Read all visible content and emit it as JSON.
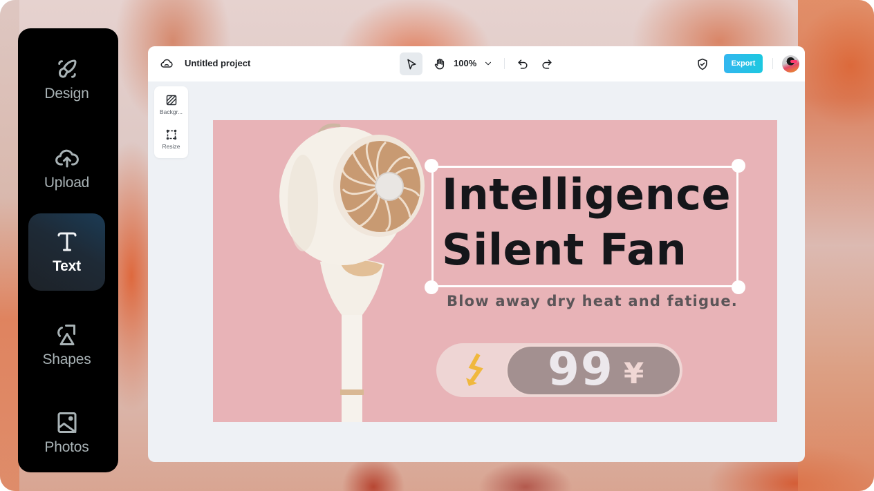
{
  "sidebar": {
    "items": [
      {
        "id": "design",
        "label": "Design",
        "icon": "rocket-icon",
        "active": false
      },
      {
        "id": "upload",
        "label": "Upload",
        "icon": "cloud-upload-icon",
        "active": false
      },
      {
        "id": "text",
        "label": "Text",
        "icon": "text-t-icon",
        "active": true
      },
      {
        "id": "shapes",
        "label": "Shapes",
        "icon": "shapes-icon",
        "active": false
      },
      {
        "id": "photos",
        "label": "Photos",
        "icon": "image-icon",
        "active": false
      }
    ]
  },
  "topbar": {
    "cloud_icon": "cloud-icon",
    "project_title": "Untitled project",
    "tools": {
      "select": "cursor-arrow-icon",
      "hand": "hand-icon"
    },
    "zoom_level": "100%",
    "undo_icon": "undo-icon",
    "redo_icon": "redo-icon",
    "shield_icon": "shield-check-icon",
    "export_label": "Export",
    "export_color": "#2bbdea",
    "avatar": "user-avatar"
  },
  "tool_panel": {
    "items": [
      {
        "label": "Backgr...",
        "icon": "background-pattern-icon"
      },
      {
        "label": "Resize",
        "icon": "resize-icon"
      }
    ]
  },
  "canvas": {
    "background_color": "#e8b3b7",
    "image": "standing-circulator-fan",
    "headline": "Intelligence\nSilent Fan",
    "subline": "Blow away dry heat and fatigue.",
    "price": {
      "icon": "lightning-bolt-icon",
      "value": "99",
      "currency": "¥"
    }
  }
}
